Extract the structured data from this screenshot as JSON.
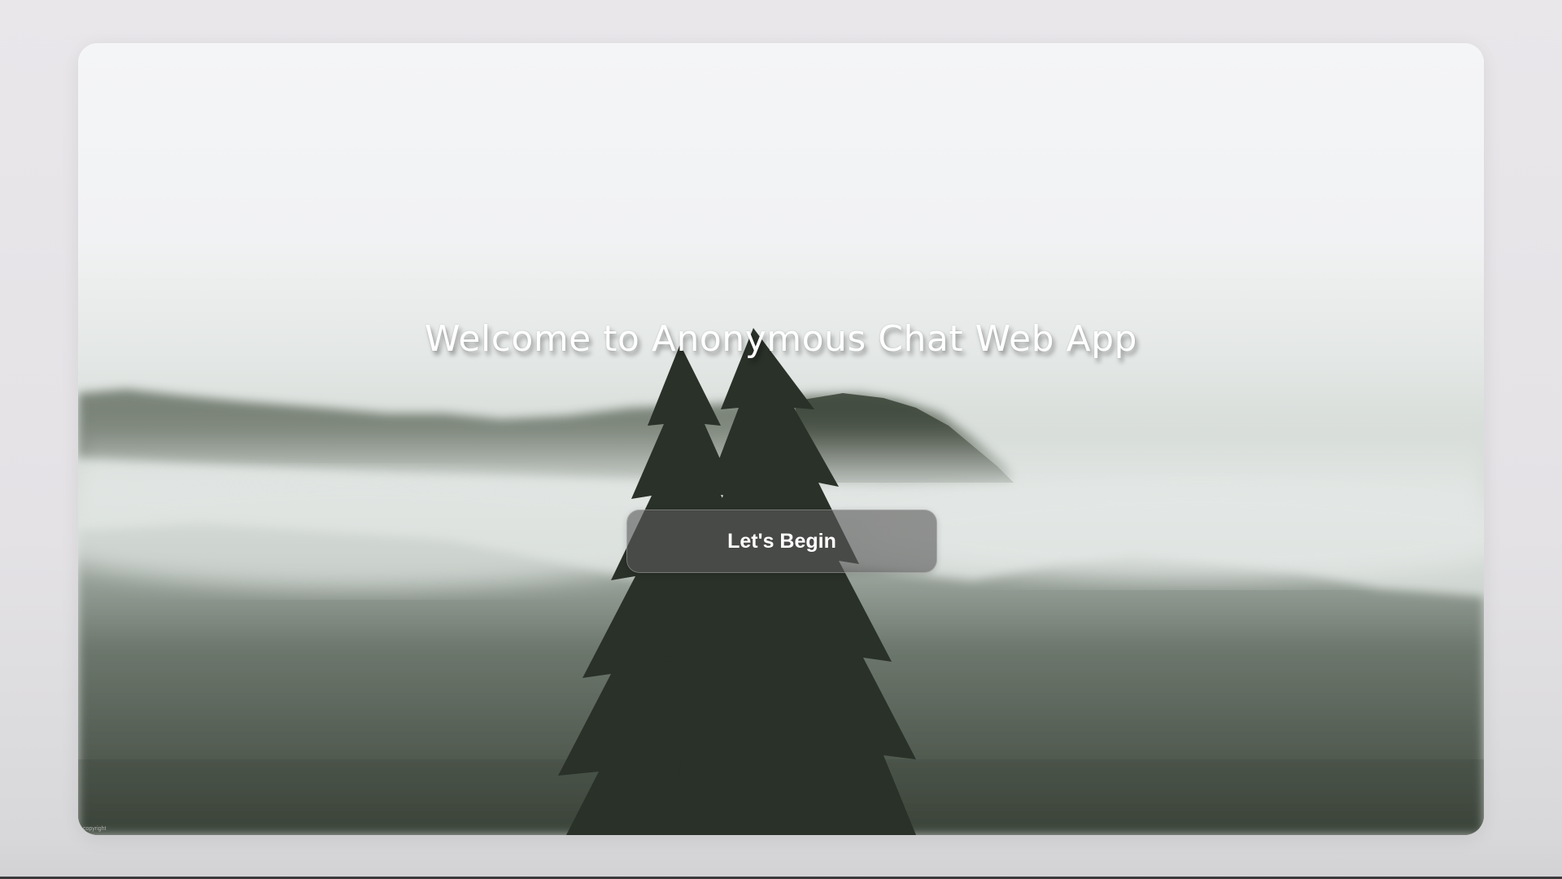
{
  "hero": {
    "title": "Welcome to Anonymous Chat Web App",
    "button_label": "Let's Begin",
    "copyright_text": "copyright"
  },
  "background": {
    "description_icon": "foggy-forest-image",
    "colors": {
      "sky": "#f3f4f6",
      "fog": "#dfe4e1",
      "forest": "#3b4338",
      "button": "#5a5a5a"
    }
  }
}
